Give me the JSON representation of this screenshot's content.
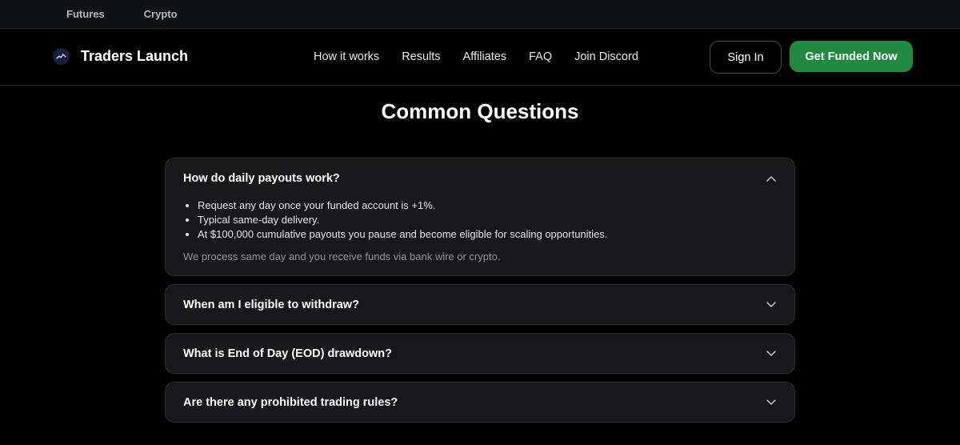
{
  "topbar": {
    "tabs": [
      "Futures",
      "Crypto"
    ]
  },
  "brand": {
    "name": "Traders Launch",
    "logo_icon": "chart-wave-icon"
  },
  "nav": {
    "links": [
      "How it works",
      "Results",
      "Affiliates",
      "FAQ",
      "Join Discord"
    ]
  },
  "actions": {
    "signin_label": "Sign In",
    "cta_label": "Get Funded Now"
  },
  "faq": {
    "title": "Common Questions",
    "items": [
      {
        "question": "How do daily payouts work?",
        "expanded": true,
        "bullets": [
          "Request any day once your funded account is +1%.",
          "Typical same-day delivery.",
          "At $100,000 cumulative payouts you pause and become eligible for scaling opportunities."
        ],
        "note": "We process same day and you receive funds via bank wire or crypto."
      },
      {
        "question": "When am I eligible to withdraw?",
        "expanded": false
      },
      {
        "question": "What is End of Day (EOD) drawdown?",
        "expanded": false
      },
      {
        "question": "Are there any prohibited trading rules?",
        "expanded": false
      }
    ]
  },
  "colors": {
    "background": "#000000",
    "card": "#18181b",
    "accent_green": "#1f8a40",
    "muted_text": "#8f9197"
  }
}
